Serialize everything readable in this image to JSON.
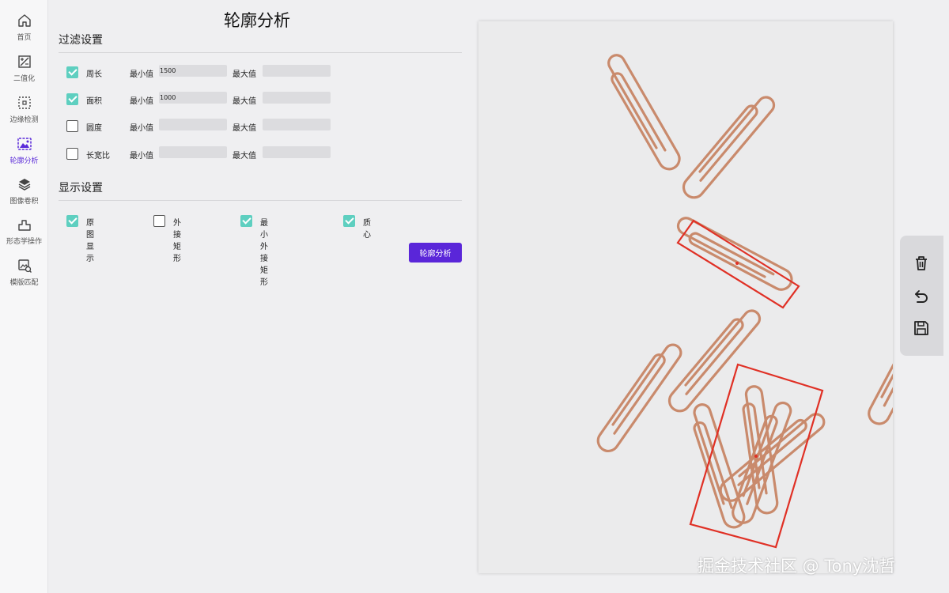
{
  "sidebar": {
    "items": [
      {
        "label": "首页",
        "icon": "home-icon"
      },
      {
        "label": "二值化",
        "icon": "binarize-icon"
      },
      {
        "label": "边缘检测",
        "icon": "edge-detect-icon"
      },
      {
        "label": "轮廓分析",
        "icon": "contour-icon",
        "active": true
      },
      {
        "label": "图像卷积",
        "icon": "layers-icon"
      },
      {
        "label": "形态学操作",
        "icon": "morphology-icon"
      },
      {
        "label": "模版匹配",
        "icon": "template-match-icon"
      }
    ]
  },
  "page_title": "轮廓分析",
  "filter": {
    "title": "过滤设置",
    "min_label": "最小值",
    "max_label": "最大值",
    "rows": [
      {
        "label": "周长",
        "checked": true,
        "min": "1500",
        "max": ""
      },
      {
        "label": "面积",
        "checked": true,
        "min": "1000",
        "max": ""
      },
      {
        "label": "圆度",
        "checked": false,
        "min": "",
        "max": ""
      },
      {
        "label": "长宽比",
        "checked": false,
        "min": "",
        "max": ""
      }
    ]
  },
  "display": {
    "title": "显示设置",
    "items": [
      {
        "label": "原图显示",
        "checked": true
      },
      {
        "label": "外接矩形",
        "checked": false
      },
      {
        "label": "最小外接矩形",
        "checked": true
      },
      {
        "label": "质心",
        "checked": true
      }
    ]
  },
  "analyze_button": "轮廓分析",
  "toolbar": {
    "items": [
      "trash-icon",
      "undo-icon",
      "save-icon"
    ]
  },
  "colors": {
    "accent": "#5a26d9",
    "checkbox": "#5ecfc0",
    "detection_box": "#e03025",
    "clip": "#c98a6c"
  },
  "watermark": "掘金技术社区 @ Tony沈哲"
}
